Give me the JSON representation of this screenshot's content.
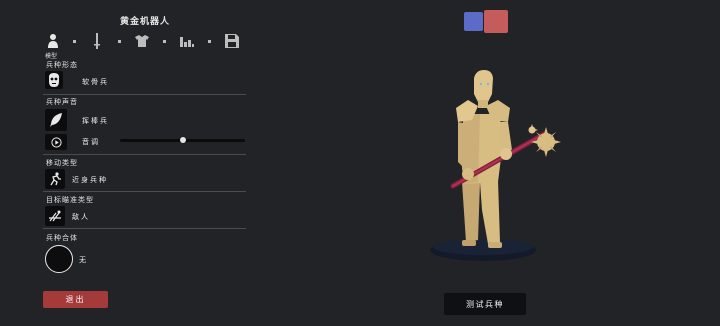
{
  "colors": {
    "background": "#222326",
    "accent_blue": "#5c6bc7",
    "accent_red": "#c65b5b",
    "exit_button": "#a43a3a",
    "unit_gold": "#d8bd82",
    "base_dark": "#141a2a"
  },
  "header": {
    "title": "黄金机器人"
  },
  "tabs": [
    {
      "icon": "person-icon",
      "label": "模型"
    },
    {
      "icon": "sword-icon"
    },
    {
      "icon": "armor-icon"
    },
    {
      "icon": "stats-icon"
    },
    {
      "icon": "save-icon"
    }
  ],
  "sections": {
    "form": {
      "heading": "兵种形态",
      "value": "软骨兵",
      "icon": "mask-icon"
    },
    "voice": {
      "heading": "兵种声音",
      "value": "挥棒兵",
      "icon": "feather-icon",
      "pitch_label": "音调",
      "pitch_icon": "play-icon",
      "pitch_level": 0.5
    },
    "movement": {
      "heading": "移动类型",
      "value": "近身兵种",
      "icon": "run-icon"
    },
    "targeting": {
      "heading": "目标瞄准类型",
      "value": "敌人",
      "icon": "target-icon"
    },
    "mount": {
      "heading": "兵种合体",
      "value": "无"
    }
  },
  "buttons": {
    "exit": "退出",
    "test_unit": "测试兵种"
  },
  "team_swatches": [
    {
      "name": "blue-team-swatch",
      "color": "#5c6bc7"
    },
    {
      "name": "red-team-swatch",
      "color": "#c65b5b"
    }
  ]
}
